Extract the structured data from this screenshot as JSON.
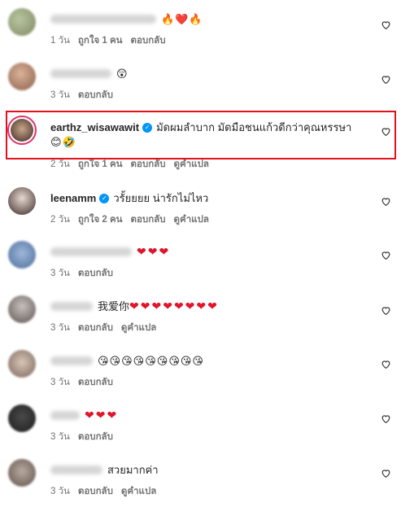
{
  "comments": [
    {
      "user_visible": false,
      "text_end": "🔥❤️🔥",
      "time": "1 วัน",
      "likes": "ถูกใจ 1 คน",
      "reply": "ตอบกลับ",
      "translate": ""
    },
    {
      "user_visible": false,
      "text_end": "😲",
      "time": "3 วัน",
      "likes": "",
      "reply": "ตอบกลับ",
      "translate": ""
    },
    {
      "username": "earthz_wisawawit",
      "text": "มัดผมลำบาก มัดมือชนแก้วดีกว่าคุณหรรษา",
      "text_line2": "😊🤣",
      "time": "2 วัน",
      "likes": "ถูกใจ 1 คน",
      "reply": "ตอบกลับ",
      "translate": "ดูคำแปล"
    },
    {
      "username": "leenamm",
      "text": "วรั้ยยยย น่ารักไม่ไหว",
      "time": "2 วัน",
      "likes": "ถูกใจ 2 คน",
      "reply": "ตอบกลับ",
      "translate": "ดูคำแปล"
    },
    {
      "text": "❤❤❤",
      "time": "3 วัน",
      "likes": "",
      "reply": "ตอบกลับ",
      "translate": ""
    },
    {
      "text": "我爱你",
      "hearts": "❤❤❤❤❤❤❤❤",
      "time": "3 วัน",
      "likes": "",
      "reply": "ตอบกลับ",
      "translate": "ดูคำแปล"
    },
    {
      "text": "😘😘😘😘😘😘😘😘😘",
      "time": "3 วัน",
      "likes": "",
      "reply": "ตอบกลับ",
      "translate": ""
    },
    {
      "text": "❤❤❤",
      "time": "3 วัน",
      "likes": "",
      "reply": "ตอบกลับ",
      "translate": ""
    },
    {
      "text": "สวยมากค่า",
      "time": "3 วัน",
      "likes": "",
      "reply": "ตอบกลับ",
      "translate": "ดูคำแปล"
    }
  ],
  "icons": {
    "like": "heart-outline-icon",
    "verified": "verified-badge-icon"
  },
  "colors": {
    "highlight": "#e3111b",
    "verified": "#0095f6",
    "heart": "#e0142a"
  }
}
